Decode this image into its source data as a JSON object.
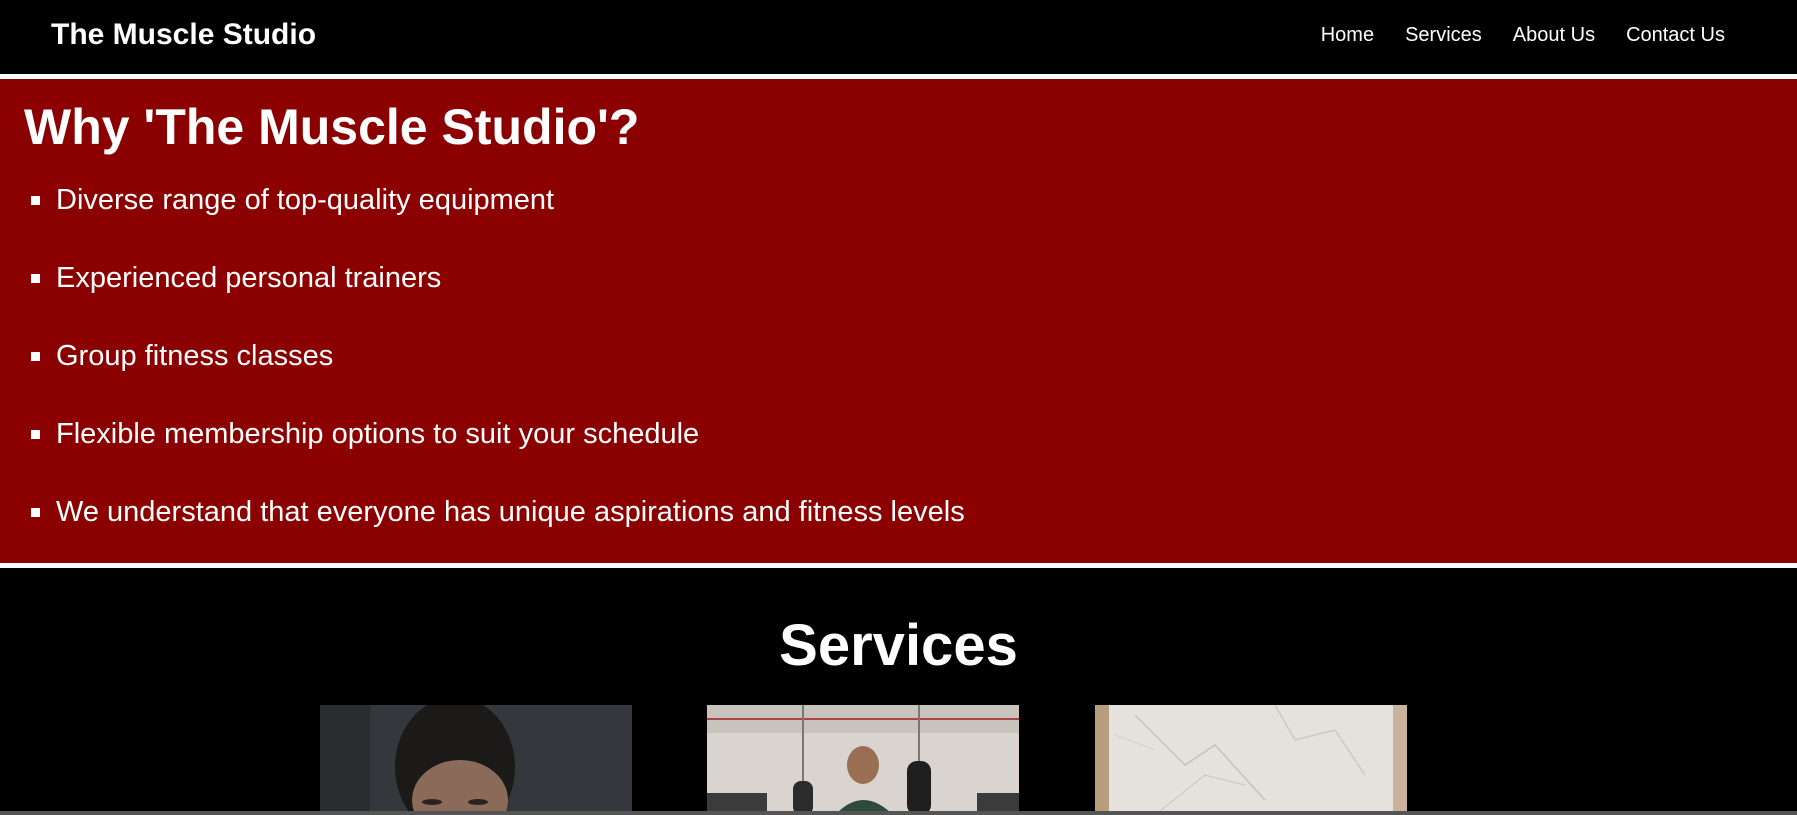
{
  "navbar": {
    "brand": "The Muscle Studio",
    "links": [
      "Home",
      "Services",
      "About Us",
      "Contact Us"
    ]
  },
  "why": {
    "title": "Why 'The Muscle Studio'?",
    "items": [
      "Diverse range of top-quality equipment",
      "Experienced personal trainers",
      "Group fitness classes",
      "Flexible membership options to suit your schedule",
      "We understand that everyone has unique aspirations and fitness levels"
    ]
  },
  "services": {
    "title": "Services"
  },
  "colors": {
    "accent": "#8b0000",
    "background": "#000000",
    "text": "#ffffff"
  }
}
